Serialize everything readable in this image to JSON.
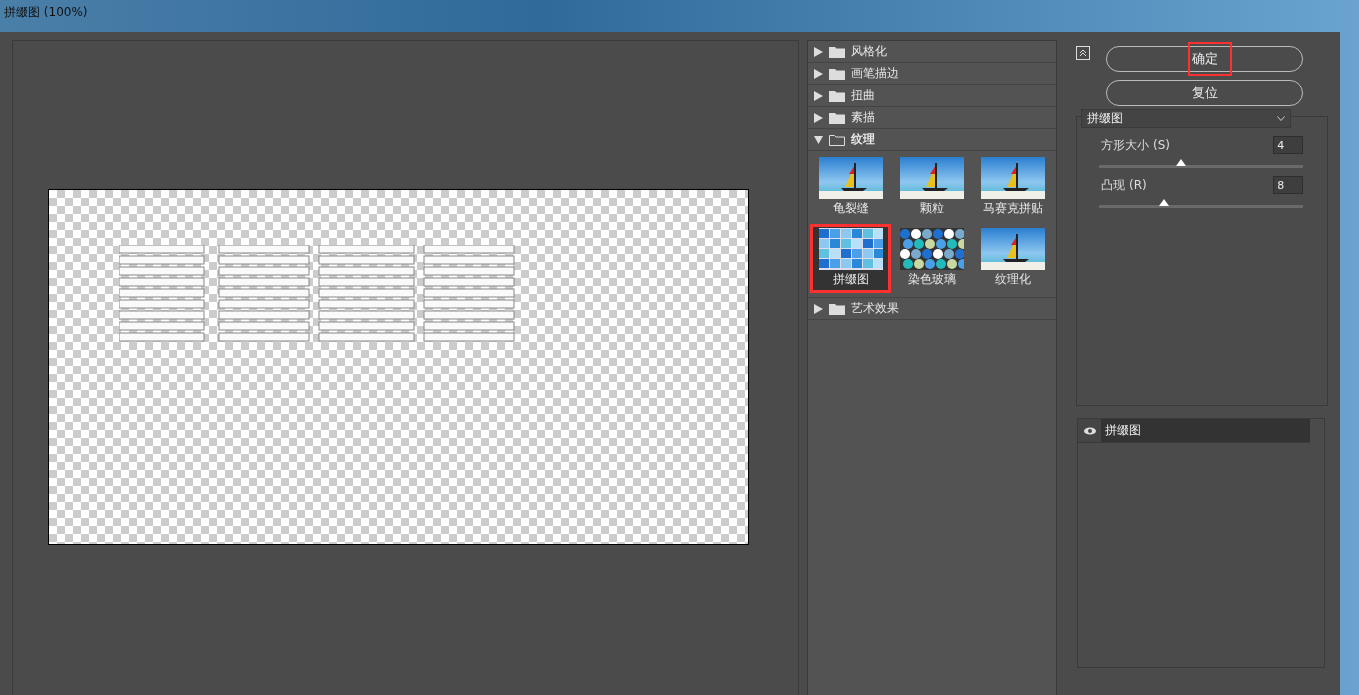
{
  "window": {
    "title": "拼缀图 (100%)"
  },
  "filter_groups": [
    {
      "label": "风格化",
      "expanded": false
    },
    {
      "label": "画笔描边",
      "expanded": false
    },
    {
      "label": "扭曲",
      "expanded": false
    },
    {
      "label": "素描",
      "expanded": false
    },
    {
      "label": "纹理",
      "expanded": true,
      "filters": [
        {
          "label": "龟裂缝",
          "kind": "sailboat",
          "selected": false,
          "annotated": false
        },
        {
          "label": "颗粒",
          "kind": "sailboat",
          "selected": false,
          "annotated": false
        },
        {
          "label": "马赛克拼贴",
          "kind": "sailboat",
          "selected": false,
          "annotated": false
        },
        {
          "label": "拼缀图",
          "kind": "tiles",
          "selected": true,
          "annotated": true
        },
        {
          "label": "染色玻璃",
          "kind": "glass",
          "selected": false,
          "annotated": false
        },
        {
          "label": "纹理化",
          "kind": "sailboat",
          "selected": false,
          "annotated": false
        }
      ]
    },
    {
      "label": "艺术效果",
      "expanded": false
    }
  ],
  "buttons": [
    {
      "label": "确定",
      "annotated": true
    },
    {
      "label": "复位",
      "annotated": false
    }
  ],
  "settings": {
    "filter": "拼缀图",
    "params": [
      {
        "label": "方形大小 (S)",
        "value": "4",
        "level": 0.4
      },
      {
        "label": "凸现 (R)",
        "value": "8",
        "level": 0.32
      }
    ]
  },
  "layers": [
    {
      "label": "拼缀图",
      "visible": true
    }
  ]
}
